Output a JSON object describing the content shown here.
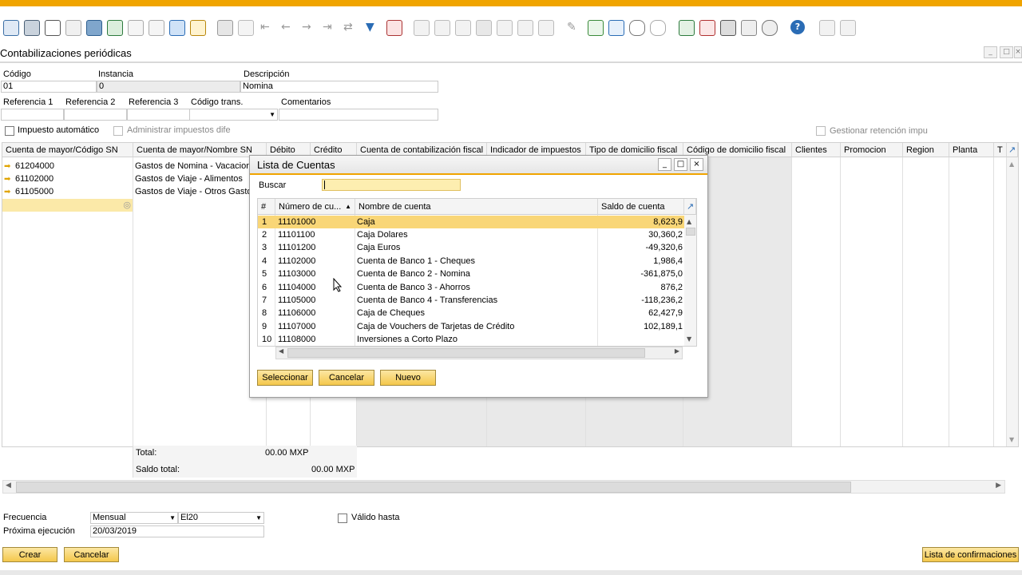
{
  "window": {
    "title": "Contabilizaciones periódicas"
  },
  "toolbar": {
    "icons": [
      "preview-icon",
      "print-icon",
      "email-icon",
      "sms-icon",
      "fax-icon",
      "excel-icon",
      "word-icon",
      "pdf-icon",
      "launch-icon",
      "lock-icon",
      "binoculars-icon",
      "filter-list-icon",
      "first-record-icon",
      "previous-record-icon",
      "next-record-icon",
      "last-record-icon",
      "refresh-icon",
      "filter-icon",
      "sort-icon",
      "base-doc-icon",
      "target-doc-icon",
      "settings-icon",
      "gross-profit-icon",
      "relationship-map-icon",
      "journal-icon",
      "edit-icon",
      "new-doc-icon",
      "approve-icon",
      "message-icon",
      "alert-icon",
      "calendar-icon",
      "close-doc-icon",
      "calculator-icon",
      "structure-icon",
      "user-icon",
      "help-icon",
      "form-settings-icon",
      "user-defined-icon"
    ]
  },
  "header": {
    "codigo_label": "Código",
    "codigo_value": "01",
    "instancia_label": "Instancia",
    "instancia_value": "0",
    "descripcion_label": "Descripción",
    "descripcion_value": "Nomina",
    "ref1_label": "Referencia 1",
    "ref2_label": "Referencia 2",
    "ref3_label": "Referencia 3",
    "codigo_trans_label": "Código trans.",
    "comentarios_label": "Comentarios",
    "impuesto_auto_label": "Impuesto automático",
    "administrar_label": "Administrar impuestos dife",
    "gestionar_label": "Gestionar retención impu"
  },
  "grid": {
    "columns": [
      "Cuenta de mayor/Código SN",
      "Cuenta de mayor/Nombre SN",
      "Débito",
      "Crédito",
      "Cuenta de contabilización fiscal",
      "Indicador de impuestos",
      "Tipo de domicilio fiscal",
      "Código de domicilio fiscal",
      "Clientes",
      "Promocion",
      "Region",
      "Planta",
      "T"
    ],
    "rows": [
      {
        "code": "61204000",
        "name": "Gastos de Nomina - Vacacion"
      },
      {
        "code": "61102000",
        "name": "Gastos de Viaje - Alimentos"
      },
      {
        "code": "61105000",
        "name": "Gastos de Viaje - Otros Gasto"
      }
    ],
    "total_label": "Total:",
    "total_debit": "00.00 MXP",
    "saldo_label": "Saldo total:",
    "saldo_credit": "00.00 MXP"
  },
  "footer": {
    "frecuencia_label": "Frecuencia",
    "frecuencia_value": "Mensual",
    "frecuencia_sub": "El20",
    "valido_label": "Válido hasta",
    "proxima_label": "Próxima ejecución",
    "proxima_value": "20/03/2019",
    "crear": "Crear",
    "cancelar": "Cancelar",
    "lista": "Lista de confirmaciones"
  },
  "dialog": {
    "title": "Lista de Cuentas",
    "buscar_label": "Buscar",
    "columns": [
      "#",
      "Número de cu...",
      "Nombre de cuenta",
      "Saldo de cuenta"
    ],
    "rows": [
      {
        "n": "1",
        "acc": "11101000",
        "name": "Caja",
        "bal": "8,623,9"
      },
      {
        "n": "2",
        "acc": "11101100",
        "name": "Caja Dolares",
        "bal": "30,360,2"
      },
      {
        "n": "3",
        "acc": "11101200",
        "name": "Caja Euros",
        "bal": "-49,320,6"
      },
      {
        "n": "4",
        "acc": "11102000",
        "name": "Cuenta de Banco 1 - Cheques",
        "bal": "1,986,4"
      },
      {
        "n": "5",
        "acc": "11103000",
        "name": "Cuenta de Banco 2 - Nomina",
        "bal": "-361,875,0"
      },
      {
        "n": "6",
        "acc": "11104000",
        "name": "Cuenta de Banco 3 - Ahorros",
        "bal": "876,2"
      },
      {
        "n": "7",
        "acc": "11105000",
        "name": "Cuenta de Banco 4 - Transferencias",
        "bal": "-118,236,2"
      },
      {
        "n": "8",
        "acc": "11106000",
        "name": "Caja de Cheques",
        "bal": "62,427,9"
      },
      {
        "n": "9",
        "acc": "11107000",
        "name": "Caja de Vouchers de Tarjetas de Crédito",
        "bal": "102,189,1"
      },
      {
        "n": "10",
        "acc": "11108000",
        "name": "Inversiones a Corto Plazo",
        "bal": ""
      }
    ],
    "seleccionar": "Seleccionar",
    "cancelar": "Cancelar",
    "nuevo": "Nuevo"
  },
  "colors": {
    "accent": "#f0a400",
    "selected_row": "#f9d677",
    "button": "#f4c74b"
  }
}
